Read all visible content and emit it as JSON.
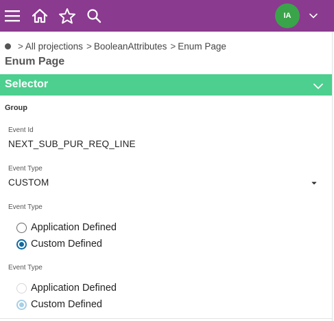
{
  "header": {
    "icons": [
      "menu-icon",
      "home-icon",
      "star-icon",
      "search-icon",
      "chevron-down-icon"
    ],
    "avatar_initials": "IA",
    "bar_color": "#8a3a8f",
    "avatar_color": "#3aa44a"
  },
  "breadcrumb": {
    "items": [
      "All projections",
      "BooleanAttributes",
      "Enum Page"
    ]
  },
  "page": {
    "title": "Enum Page"
  },
  "selector": {
    "label": "Selector",
    "color": "#4dcf8f"
  },
  "group": {
    "title": "Group",
    "event_id": {
      "label": "Event Id",
      "value": "NEXT_SUB_PUR_REQ_LINE"
    },
    "event_type_select": {
      "label": "Event Type",
      "value": "CUSTOM"
    },
    "event_type_radio": {
      "label": "Event Type",
      "options": [
        "Application Defined",
        "Custom Defined"
      ],
      "selected": "Custom Defined",
      "enabled": true
    },
    "event_type_radio_disabled": {
      "label": "Event Type",
      "options": [
        "Application Defined",
        "Custom Defined"
      ],
      "selected": "Custom Defined",
      "enabled": false
    }
  }
}
